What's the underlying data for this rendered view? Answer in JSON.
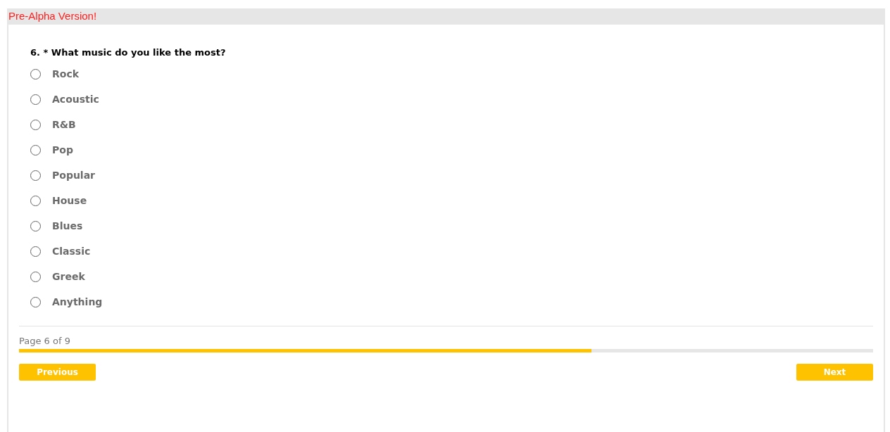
{
  "banner": "Pre-Alpha Version!",
  "question": {
    "title": "6. * What music do you like the most?",
    "options": [
      {
        "label": "Rock",
        "selected": false
      },
      {
        "label": "Acoustic",
        "selected": false
      },
      {
        "label": "R&B",
        "selected": false
      },
      {
        "label": "Pop",
        "selected": false
      },
      {
        "label": "Popular",
        "selected": false
      },
      {
        "label": "House",
        "selected": false
      },
      {
        "label": "Blues",
        "selected": false
      },
      {
        "label": "Classic",
        "selected": false
      },
      {
        "label": "Greek",
        "selected": false
      },
      {
        "label": "Anything",
        "selected": false
      }
    ]
  },
  "progress": {
    "label": "Page 6 of 9",
    "level": 0.67
  },
  "buttons": {
    "previous": "Previous",
    "next": "Next"
  }
}
